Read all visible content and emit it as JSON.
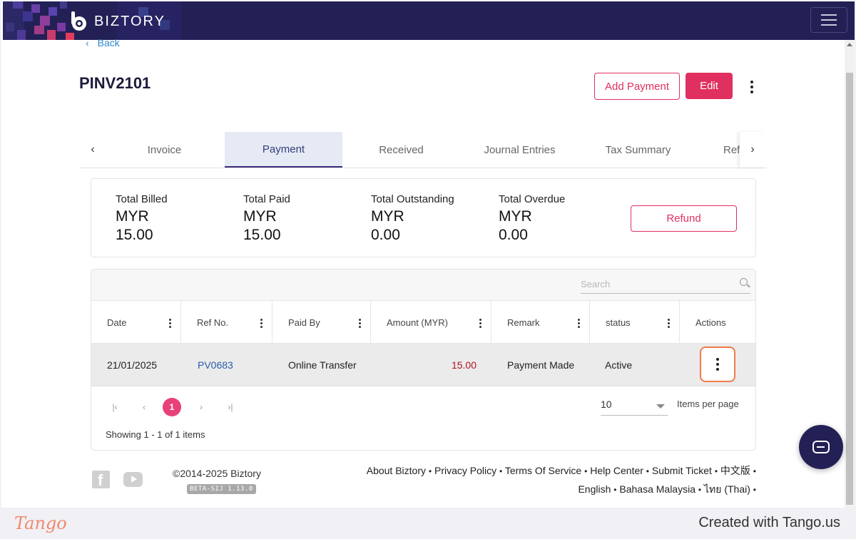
{
  "header": {
    "brand": "BIZTORY",
    "menu_icon": "hamburger-icon"
  },
  "nav": {
    "back_label": "Back"
  },
  "document": {
    "title": "PINV2101",
    "add_payment_label": "Add Payment",
    "edit_label": "Edit"
  },
  "tabs": [
    {
      "label": "Invoice",
      "active": false
    },
    {
      "label": "Payment",
      "active": true
    },
    {
      "label": "Received",
      "active": false
    },
    {
      "label": "Journal Entries",
      "active": false
    },
    {
      "label": "Tax Summary",
      "active": false
    },
    {
      "label": "Refe",
      "active": false
    }
  ],
  "summary": {
    "items": [
      {
        "label": "Total Billed",
        "currency": "MYR",
        "value": "15.00"
      },
      {
        "label": "Total Paid",
        "currency": "MYR",
        "value": "15.00"
      },
      {
        "label": "Total Outstanding",
        "currency": "MYR",
        "value": "0.00"
      },
      {
        "label": "Total Overdue",
        "currency": "MYR",
        "value": "0.00"
      }
    ],
    "refund_label": "Refund"
  },
  "grid": {
    "search_placeholder": "Search",
    "columns": [
      "Date",
      "Ref No.",
      "Paid By",
      "Amount (MYR)",
      "Remark",
      "status",
      "Actions"
    ],
    "rows": [
      {
        "date": "21/01/2025",
        "ref": "PV0683",
        "paid_by": "Online Transfer",
        "amount": "15.00",
        "remark": "Payment Made",
        "status": "Active"
      }
    ],
    "pager": {
      "current_page": "1",
      "page_size": "10",
      "items_per_page_label": "Items per page",
      "showing": "Showing 1 - 1 of 1 items"
    }
  },
  "footer": {
    "copyright": "©2014-2025 Biztory",
    "version": "BETA-SIJ 1.13.0",
    "links": [
      "About Biztory",
      "Privacy Policy",
      "Terms Of Service",
      "Help Center",
      "Submit Ticket",
      "中文版",
      "English",
      "Bahasa Malaysia",
      "ไทย (Thai)"
    ]
  },
  "tango": {
    "logo": "Tango",
    "credit": "Created with Tango.us"
  },
  "colors": {
    "header_bg": "#232056",
    "accent": "#e0305f",
    "active_tab_bg": "#e6eaf4",
    "link": "#2a5caa",
    "amount": "#b3121f",
    "highlight": "#f07c4a"
  }
}
